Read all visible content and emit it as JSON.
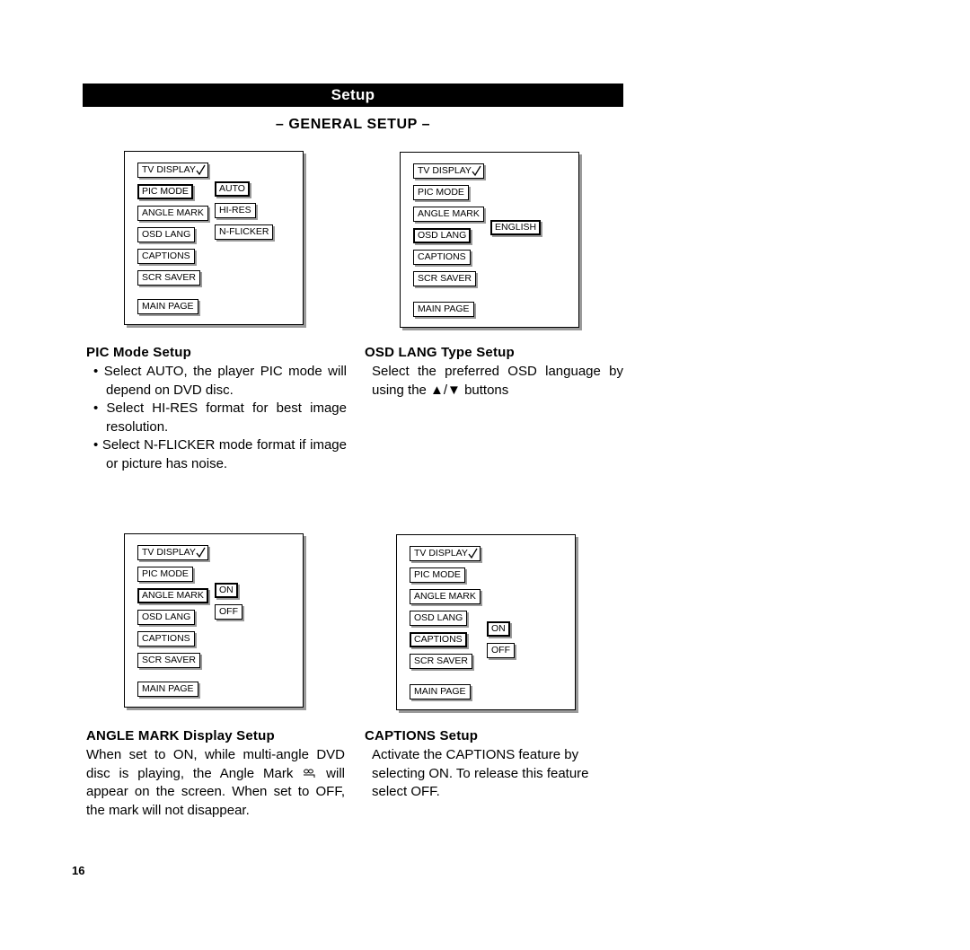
{
  "document": {
    "title": "Setup",
    "section_title": "– GENERAL SETUP –",
    "page_number": "16"
  },
  "osd_menu_labels": {
    "tv_display": "TV DISPLAY",
    "pic_mode": "PIC MODE",
    "angle_mark": "ANGLE MARK",
    "osd_lang": "OSD LANG",
    "captions": "CAPTIONS",
    "scr_saver": "SCR SAVER",
    "main_page": "MAIN PAGE"
  },
  "screens": [
    {
      "id": "pic-mode-screen",
      "menu": [
        "TV DISPLAY",
        "PIC MODE",
        "ANGLE MARK",
        "OSD LANG",
        "CAPTIONS",
        "SCR SAVER"
      ],
      "highlighted_menu": "PIC MODE",
      "values": [
        "AUTO",
        "HI-RES",
        "N-FLICKER"
      ],
      "highlighted_value": "AUTO",
      "main_page": "MAIN PAGE"
    },
    {
      "id": "osd-lang-screen",
      "menu": [
        "TV DISPLAY",
        "PIC MODE",
        "ANGLE MARK",
        "OSD LANG",
        "CAPTIONS",
        "SCR SAVER"
      ],
      "highlighted_menu": "OSD LANG",
      "values": [
        "ENGLISH"
      ],
      "highlighted_value": "ENGLISH",
      "main_page": "MAIN PAGE"
    },
    {
      "id": "angle-mark-screen",
      "menu": [
        "TV DISPLAY",
        "PIC MODE",
        "ANGLE MARK",
        "OSD LANG",
        "CAPTIONS",
        "SCR SAVER"
      ],
      "highlighted_menu": "ANGLE MARK",
      "values": [
        "ON",
        "OFF"
      ],
      "highlighted_value": "ON",
      "main_page": "MAIN PAGE"
    },
    {
      "id": "captions-screen",
      "menu": [
        "TV DISPLAY",
        "PIC MODE",
        "ANGLE MARK",
        "OSD LANG",
        "CAPTIONS",
        "SCR SAVER"
      ],
      "highlighted_menu": "CAPTIONS",
      "values": [
        "ON",
        "OFF"
      ],
      "highlighted_value": "ON",
      "main_page": "MAIN PAGE"
    }
  ],
  "sections": {
    "pic_mode": {
      "heading": "PIC Mode Setup",
      "bullets": [
        "• Select AUTO, the player PIC mode will depend on DVD disc.",
        "• Select HI-RES format for best image resolution.",
        "• Select N-FLICKER mode format if image or picture has noise."
      ]
    },
    "osd_lang": {
      "heading": "OSD LANG Type Setup",
      "text": "Select the preferred OSD language by using the ▲/▼ buttons"
    },
    "angle_mark": {
      "heading": "ANGLE MARK Display Setup",
      "text_part1": "When set to ON, while  multi-angle DVD disc is playing, the Angle Mark",
      "text_part2": "will appear on the screen. When set to OFF, the mark will not disappear."
    },
    "captions": {
      "heading": "CAPTIONS Setup",
      "text": "Activate the CAPTIONS feature by selecting ON. To release this feature select OFF."
    }
  }
}
